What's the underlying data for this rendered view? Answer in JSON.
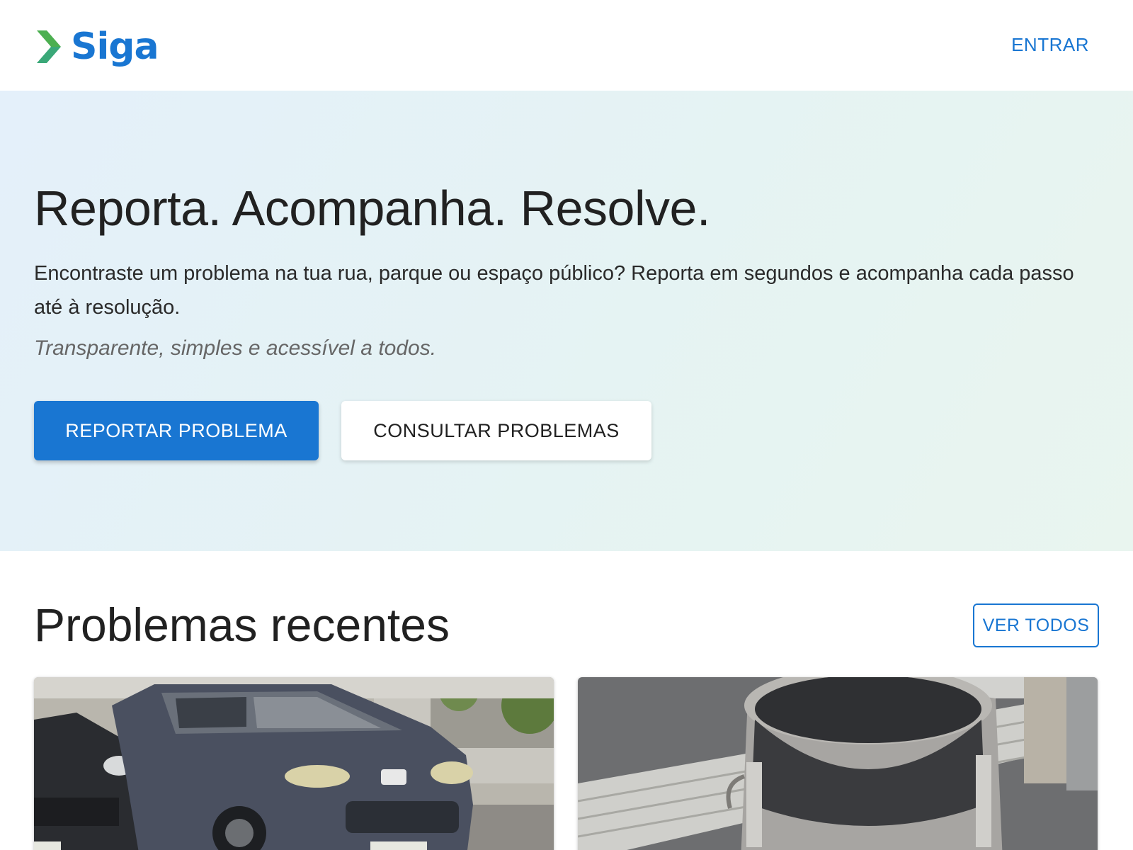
{
  "header": {
    "logo_text": "Siga",
    "login_label": "ENTRAR"
  },
  "hero": {
    "title": "Reporta. Acompanha. Resolve.",
    "description": "Encontraste um problema na tua rua, parque ou espaço público? Reporta em segundos e acompanha cada passo até à resolução.",
    "tagline": "Transparente, simples e acessível a todos.",
    "primary_button": "REPORTAR PROBLEMA",
    "secondary_button": "CONSULTAR PROBLEMAS"
  },
  "recent": {
    "title": "Problemas recentes",
    "view_all": "VER TODOS",
    "cards": [
      {
        "image": "photo-parked-cars"
      },
      {
        "image": "photo-metal-bin"
      }
    ]
  },
  "colors": {
    "brand": "#1976d2",
    "logo_arrow_top": "#4caf50",
    "logo_arrow_bottom": "#2e9b6b",
    "hero_bg": "#e5f2f5"
  }
}
